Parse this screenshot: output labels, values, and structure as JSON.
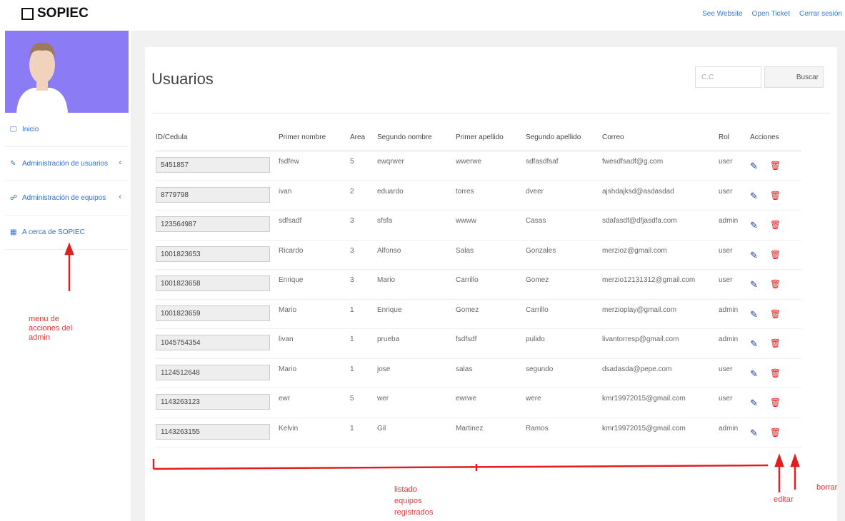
{
  "brand": "SOPIEC",
  "top_links": [
    "See Website",
    "Open Ticket",
    "Cerrar sesión"
  ],
  "sidebar": {
    "items": [
      {
        "label": "Inicio",
        "icon": "monitor-icon"
      },
      {
        "label": "Administración de usuarios",
        "icon": "edit-icon"
      },
      {
        "label": "Administración de equipos",
        "icon": "sitemap-icon"
      },
      {
        "label": "A cerca de SOPIEC",
        "icon": "grid-icon"
      }
    ]
  },
  "page": {
    "title": "Usuarios",
    "search_placeholder": "C.C",
    "search_button": "Buscar"
  },
  "table": {
    "headers": [
      "ID/Cedula",
      "Primer nombre",
      "Area",
      "Segundo nombre",
      "Primer apellido",
      "Segundo apellido",
      "Correo",
      "Rol",
      "Acciones"
    ],
    "rows": [
      [
        "5451857",
        "fsdfew",
        "5",
        "ewqrwer",
        "wwerwe",
        "sdfasdfsaf",
        "fwesdfsadf@g.com",
        "user"
      ],
      [
        "8779798",
        "ivan",
        "2",
        "eduardo",
        "torres",
        "dveer",
        "ajshdajksd@asdasdad",
        "user"
      ],
      [
        "123564987",
        "sdfsadf",
        "3",
        "sfsfa",
        "wwww",
        "Casas",
        "sdafasdf@dfjasdfa.com",
        "admin"
      ],
      [
        "1001823653",
        "Ricardo",
        "3",
        "Alfonso",
        "Salas",
        "Gonzales",
        "merzioz@gmail.com",
        "user"
      ],
      [
        "1001823658",
        "Enrique",
        "3",
        "Mario",
        "Carrillo",
        "Gomez",
        "merzio12131312@gmail.com",
        "user"
      ],
      [
        "1001823659",
        "Mario",
        "1",
        "Enrique",
        "Gomez",
        "Carrillo",
        "merzioplay@gmail.com",
        "admin"
      ],
      [
        "1045754354",
        "livan",
        "1",
        "prueba",
        "fsdfsdf",
        "pulido",
        "livantorresp@gmail.com",
        "admin"
      ],
      [
        "1124512648",
        "Mario",
        "1",
        "jose",
        "salas",
        "segundo",
        "dsadasda@pepe.com",
        "user"
      ],
      [
        "1143263123",
        "ewr",
        "5",
        "wer",
        "ewrwe",
        "were",
        "kmr19972015@gmail.com",
        "user"
      ],
      [
        "1143263155",
        "Kelvin",
        "1",
        "Gil",
        "Martinez",
        "Ramos",
        "kmr19972015@gmail.com",
        "admin"
      ]
    ]
  },
  "annotations": {
    "menu": "menu de acciones del admin",
    "listado": "listado equipos registrados",
    "editar": "editar",
    "borrar": "borrar"
  },
  "colors": {
    "accent": "#8b7cf6",
    "link": "#2f6fdb",
    "annotation": "#e33333"
  }
}
